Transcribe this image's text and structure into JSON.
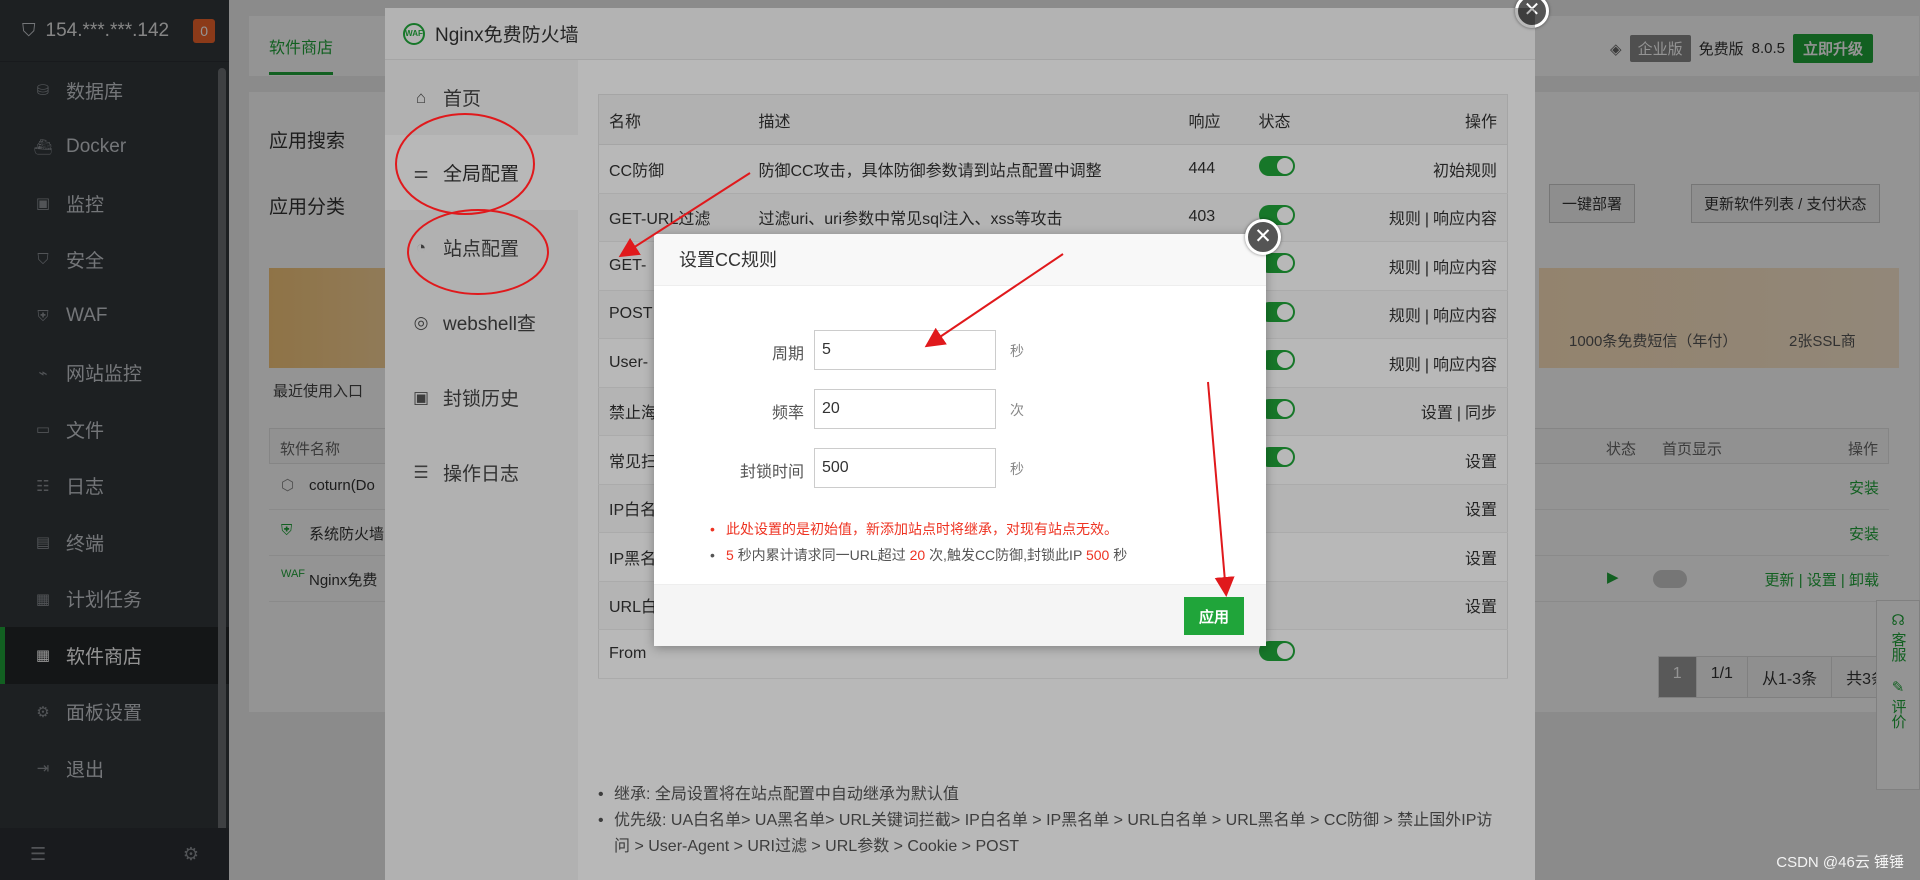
{
  "sidebar": {
    "server_ip": "154.***.***.142",
    "alert_count": "0",
    "items": [
      {
        "label": "数据库",
        "icon": "database-icon"
      },
      {
        "label": "Docker",
        "icon": "docker-icon"
      },
      {
        "label": "监控",
        "icon": "monitor-icon"
      },
      {
        "label": "安全",
        "icon": "shield-icon"
      },
      {
        "label": "WAF",
        "icon": "waf-icon"
      },
      {
        "label": "网站监控",
        "icon": "chart-icon"
      },
      {
        "label": "文件",
        "icon": "folder-icon"
      },
      {
        "label": "日志",
        "icon": "log-icon"
      },
      {
        "label": "终端",
        "icon": "terminal-icon"
      },
      {
        "label": "计划任务",
        "icon": "calendar-icon"
      },
      {
        "label": "软件商店",
        "icon": "grid-icon"
      },
      {
        "label": "面板设置",
        "icon": "gear-icon"
      },
      {
        "label": "退出",
        "icon": "logout-icon"
      }
    ]
  },
  "page": {
    "tab_store": "软件商店",
    "edition_enterprise": "企业版",
    "edition_free": "免费版",
    "version": "8.0.5",
    "upgrade_label": "立即升级",
    "search_label": "应用搜索",
    "category_label": "应用分类",
    "one_click_deploy": "一键部署",
    "update_list": "更新软件列表 / 支付状态",
    "sms_promo": "1000条免费短信（年付）",
    "ssl_promo": "2张SSL商",
    "recent_label": "最近使用入口",
    "table_col_name": "软件名称",
    "table_col_status": "状态",
    "table_col_home": "首页显示",
    "table_col_ops": "操作",
    "rows": [
      {
        "name": "coturn(Do",
        "op": "安装"
      },
      {
        "name": "系统防火墙",
        "op": "安装"
      },
      {
        "name": "Nginx免费",
        "op": "更新 | 设置 | 卸载"
      }
    ],
    "pager": [
      "1",
      "1/1",
      "从1-3条",
      "共3条"
    ],
    "float_service": "客服",
    "float_rate": "评价"
  },
  "waf": {
    "title": "Nginx免费防火墙",
    "nav": [
      {
        "label": "首页",
        "icon": "home-icon"
      },
      {
        "label": "全局配置",
        "icon": "sliders-icon"
      },
      {
        "label": "站点配置",
        "icon": "globe-icon"
      },
      {
        "label": "webshell查",
        "icon": "scan-icon"
      },
      {
        "label": "封锁历史",
        "icon": "lock-icon"
      },
      {
        "label": "操作日志",
        "icon": "doc-icon"
      }
    ],
    "headers": {
      "name": "名称",
      "desc": "描述",
      "code": "响应",
      "status": "状态",
      "ops": "操作"
    },
    "rules": [
      {
        "name": "CC防御",
        "desc": "防御CC攻击，具体防御参数请到站点配置中调整",
        "code": "444",
        "ops": [
          "初始规则"
        ]
      },
      {
        "name": "GET-URL过滤",
        "desc": "过滤uri、uri参数中常见sql注入、xss等攻击",
        "code": "403",
        "ops": [
          "规则",
          "响应内容"
        ]
      },
      {
        "name": "GET-",
        "desc": "",
        "code": "",
        "ops": [
          "规则",
          "响应内容"
        ]
      },
      {
        "name": "POST",
        "desc": "",
        "code": "",
        "ops": [
          "规则",
          "响应内容"
        ]
      },
      {
        "name": "User-",
        "desc": "",
        "code": "",
        "ops": [
          "规则",
          "响应内容"
        ]
      },
      {
        "name": "禁止海",
        "desc": "",
        "code": "",
        "ops": [
          "设置",
          "同步"
        ]
      },
      {
        "name": "常见扫",
        "desc": "",
        "code": "",
        "ops": [
          "设置"
        ]
      },
      {
        "name": "IP白名",
        "desc": "",
        "code": "--",
        "ops": [
          "设置"
        ]
      },
      {
        "name": "IP黑名",
        "desc": "",
        "code": "--",
        "ops": [
          "设置"
        ]
      },
      {
        "name": "URL白",
        "desc": "",
        "code": "--",
        "ops": [
          "设置"
        ]
      },
      {
        "name": "From",
        "desc": "",
        "code": "",
        "ops": []
      }
    ],
    "notes": [
      "继承: 全局设置将在站点配置中自动继承为默认值",
      "优先级: UA白名单> UA黑名单> URL关键词拦截> IP白名单 > IP黑名单 > URL白名单 > URL黑名单 > CC防御 > 禁止国外IP访问 > User-Agent > URI过滤 > URL参数 > Cookie > POST"
    ]
  },
  "cc_dialog": {
    "title": "设置CC规则",
    "cycle_label": "周期",
    "cycle_value": "5",
    "cycle_unit": "秒",
    "freq_label": "频率",
    "freq_value": "20",
    "freq_unit": "次",
    "block_label": "封锁时间",
    "block_value": "500",
    "block_unit": "秒",
    "tip1": "此处设置的是初始值，新添加站点时将继承，对现有站点无效。",
    "tip2_a": "5",
    "tip2_b": "秒内累计请求同一URL超过",
    "tip2_c": "20",
    "tip2_d": "次,触发CC防御,封锁此IP",
    "tip2_e": "500",
    "tip2_f": "秒",
    "apply_label": "应用"
  },
  "watermark": "CSDN @46云 锤锤",
  "colors": {
    "accent": "#20a53a",
    "annotation": "#e0191c",
    "sidebar": "#32373c"
  }
}
